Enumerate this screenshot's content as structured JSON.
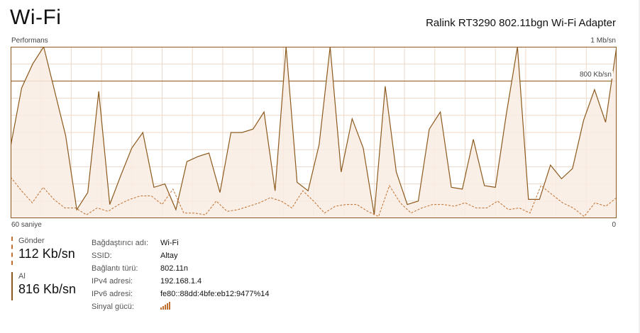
{
  "header": {
    "title": "Wi-Fi",
    "adapter": "Ralink RT3290 802.11bgn Wi-Fi Adapter"
  },
  "graph": {
    "label": "Performans",
    "max_label": "1 Mb/sn",
    "scale_label": "800 Kb/sn",
    "time_label": "60 saniye",
    "zero_label": "0"
  },
  "stats": {
    "send_label": "Gönder",
    "send_value": "112 Kb/sn",
    "recv_label": "Al",
    "recv_value": "816 Kb/sn"
  },
  "info": {
    "rows": [
      {
        "key": "Bağdaştırıcı adı:",
        "value": "Wi-Fi"
      },
      {
        "key": "SSID:",
        "value": "Altay"
      },
      {
        "key": "Bağlantı türü:",
        "value": "802.11n"
      },
      {
        "key": "IPv4 adresi:",
        "value": "192.168.1.4"
      },
      {
        "key": "IPv6 adresi:",
        "value": "fe80::88dd:4bfe:eb12:9477%14"
      },
      {
        "key": "Sinyal gücü:",
        "icon": "signal-bars-icon"
      }
    ]
  },
  "colors": {
    "receive_line": "#8c5a1e",
    "send_line": "#c07030",
    "fill": "#f9ece2",
    "grid": "#ecd8c8",
    "border": "#8c5a1e"
  },
  "chart_data": {
    "type": "area",
    "unit": "Kb/sn",
    "ylim": [
      0,
      1000
    ],
    "x_range": [
      60,
      0
    ],
    "series": [
      {
        "name": "Al",
        "values": [
          420,
          760,
          900,
          1000,
          740,
          480,
          50,
          150,
          740,
          80,
          250,
          410,
          500,
          180,
          200,
          50,
          330,
          360,
          380,
          150,
          500,
          500,
          520,
          620,
          160,
          1000,
          210,
          160,
          430,
          1000,
          270,
          580,
          410,
          20,
          770,
          270,
          80,
          100,
          520,
          620,
          180,
          170,
          460,
          190,
          180,
          610,
          1000,
          110,
          110,
          310,
          230,
          290,
          570,
          750,
          560,
          1000
        ]
      },
      {
        "name": "Gönder",
        "values": [
          240,
          160,
          90,
          180,
          110,
          60,
          60,
          20,
          60,
          40,
          80,
          110,
          130,
          130,
          80,
          170,
          30,
          30,
          20,
          100,
          40,
          50,
          70,
          90,
          120,
          100,
          60,
          160,
          100,
          30,
          70,
          80,
          80,
          40,
          10,
          190,
          90,
          30,
          60,
          80,
          80,
          70,
          90,
          60,
          60,
          100,
          50,
          60,
          30,
          190,
          140,
          90,
          60,
          10,
          90,
          70,
          120
        ]
      }
    ]
  }
}
